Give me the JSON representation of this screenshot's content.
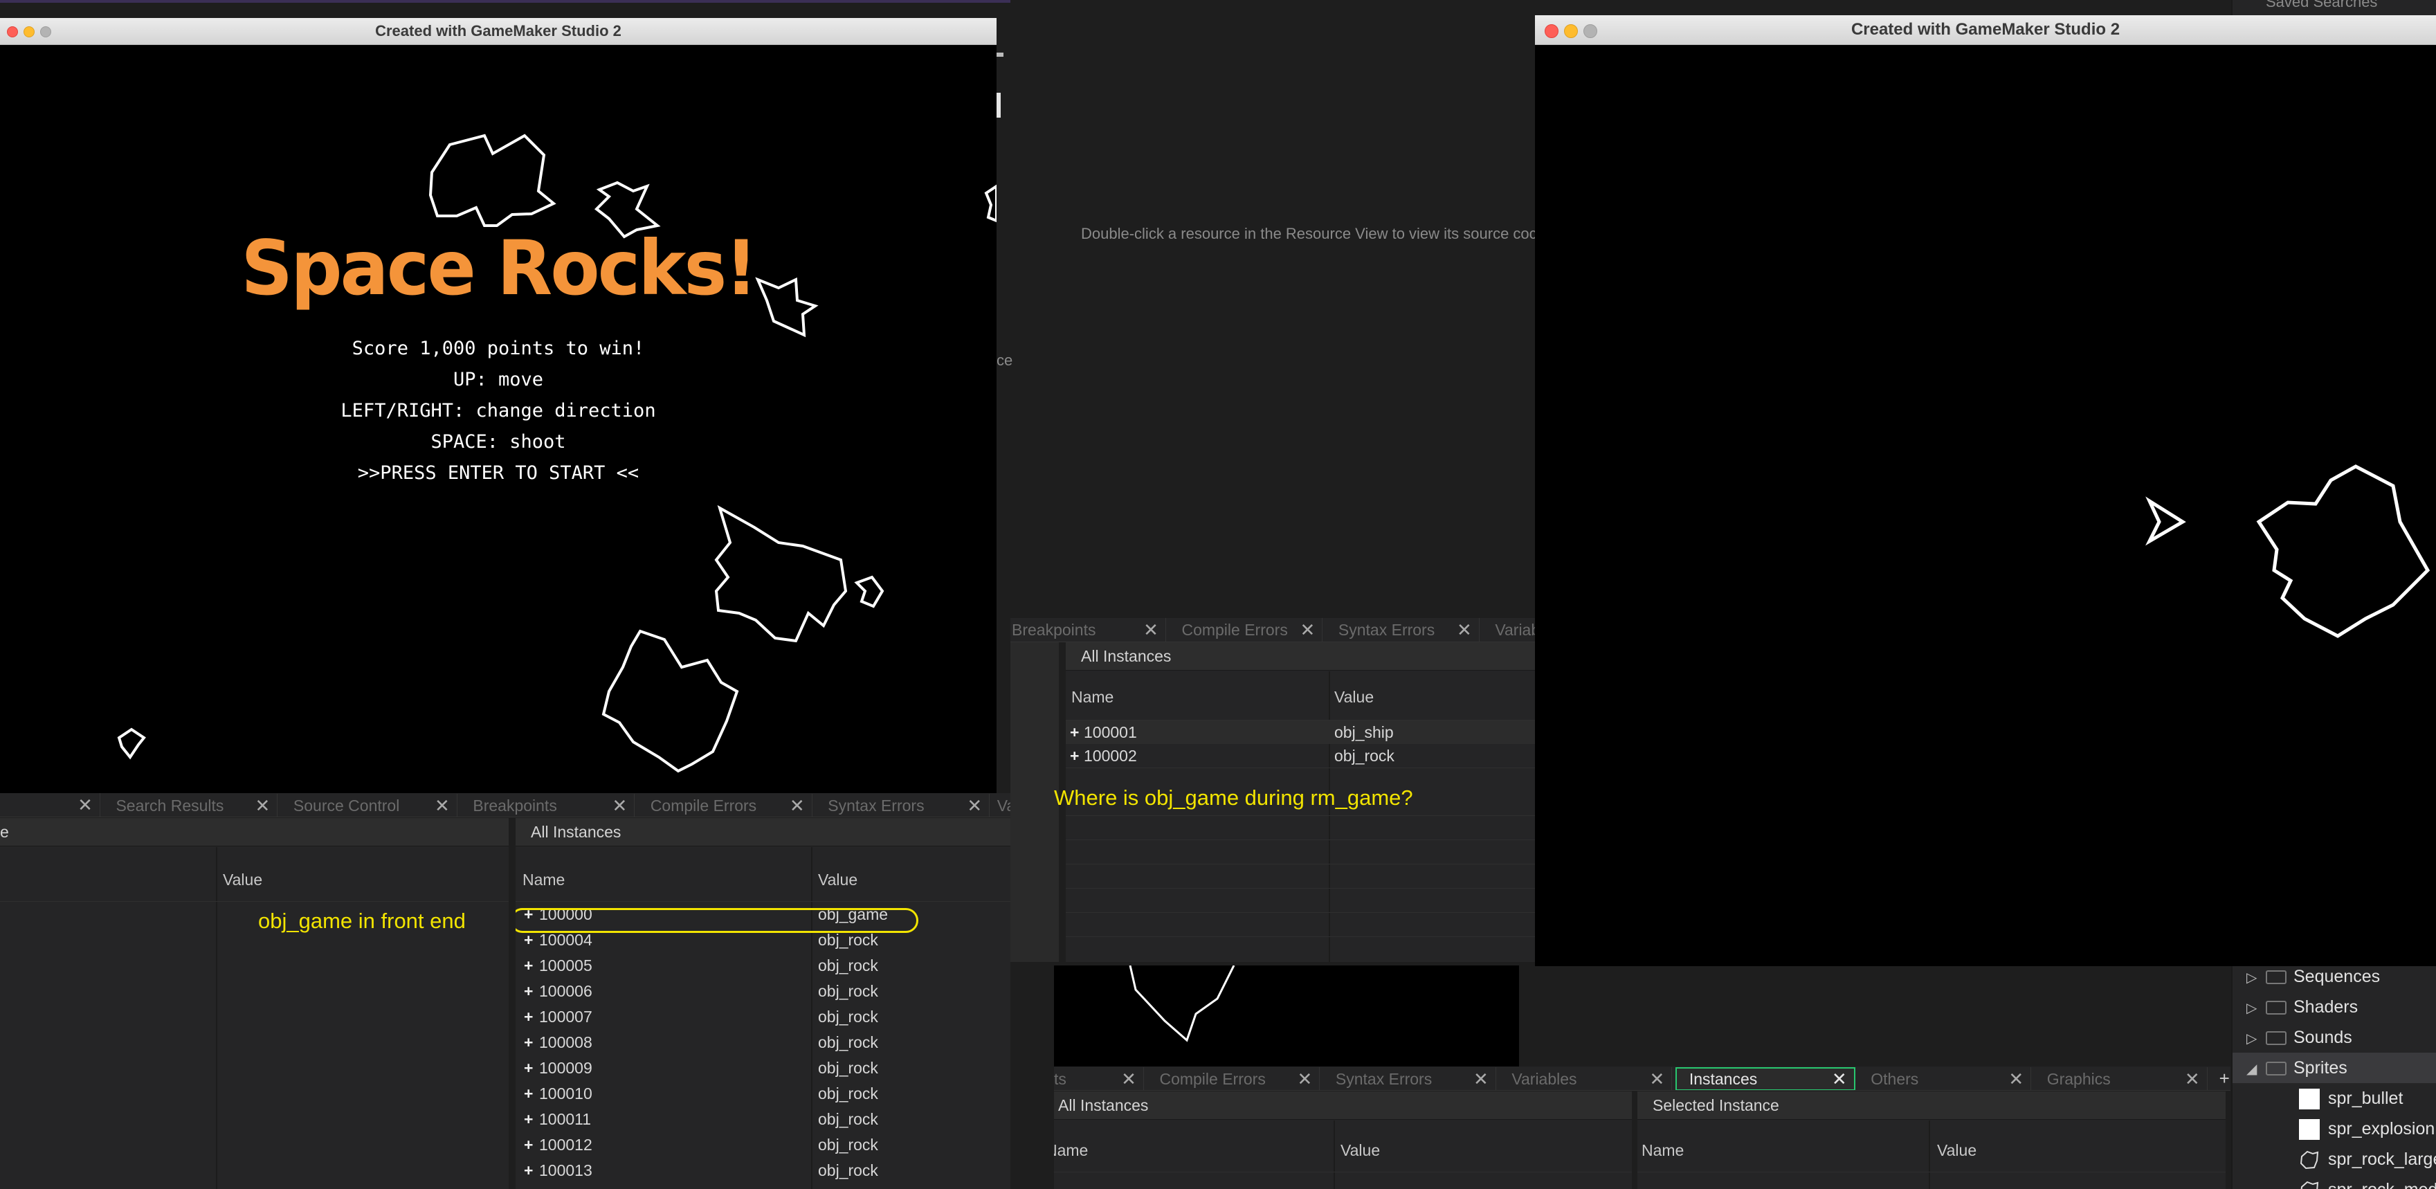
{
  "game_window_left": {
    "title": "Created with GameMaker Studio 2",
    "logo": "Space Rocks!",
    "lines": [
      "Score 1,000 points to win!",
      "UP: move",
      "LEFT/RIGHT: change direction",
      "SPACE: shoot",
      ">>PRESS ENTER TO START <<"
    ]
  },
  "game_window_right": {
    "title": "Created with GameMaker Studio 2"
  },
  "ide_center": {
    "hint": "Double-click a resource in the Resource View to view its source coc",
    "fragment_ce": "ce",
    "top_tabs": [
      "Breakpoints",
      "Compile Errors",
      "Syntax Errors",
      "Variable"
    ],
    "panel_title": "All Instances",
    "col_name": "Name",
    "col_value": "Value",
    "rows": [
      {
        "id": "100001",
        "value": "obj_ship"
      },
      {
        "id": "100002",
        "value": "obj_rock"
      }
    ],
    "annotation": "Where is obj_game during rm_game?"
  },
  "ide_left_bottom": {
    "tabs": [
      "Search Results",
      "Source Control",
      "Breakpoints",
      "Compile Errors",
      "Syntax Errors",
      "Varia"
    ],
    "left_panel_fragment": "e",
    "left_col_value": "Value",
    "annotation": "obj_game in front end",
    "panel_title": "All Instances",
    "col_name": "Name",
    "col_value": "Value",
    "rows": [
      {
        "id": "100000",
        "value": "obj_game"
      },
      {
        "id": "100004",
        "value": "obj_rock"
      },
      {
        "id": "100005",
        "value": "obj_rock"
      },
      {
        "id": "100006",
        "value": "obj_rock"
      },
      {
        "id": "100007",
        "value": "obj_rock"
      },
      {
        "id": "100008",
        "value": "obj_rock"
      },
      {
        "id": "100009",
        "value": "obj_rock"
      },
      {
        "id": "100010",
        "value": "obj_rock"
      },
      {
        "id": "100011",
        "value": "obj_rock"
      },
      {
        "id": "100012",
        "value": "obj_rock"
      },
      {
        "id": "100013",
        "value": "obj_rock"
      }
    ]
  },
  "ide_right_bottom": {
    "tabs": [
      "ts",
      "Compile Errors",
      "Syntax Errors",
      "Variables",
      "Instances",
      "Others",
      "Graphics"
    ],
    "active_tab": "Instances",
    "all_instances": {
      "title": "All Instances",
      "col_name": "Name",
      "col_value": "Value",
      "name_fragment": "Name"
    },
    "selected_instance": {
      "title": "Selected Instance",
      "col_name": "Name",
      "col_value": "Value"
    }
  },
  "resource_tree": {
    "top_fragment": "Saved Searches",
    "items": [
      {
        "label": "Sequences",
        "kind": "folder",
        "expanded": false
      },
      {
        "label": "Shaders",
        "kind": "folder",
        "expanded": false
      },
      {
        "label": "Sounds",
        "kind": "folder",
        "expanded": false
      },
      {
        "label": "Sprites",
        "kind": "folder",
        "expanded": true
      },
      {
        "label": "spr_bullet",
        "kind": "sprite"
      },
      {
        "label": "spr_explosion",
        "kind": "sprite"
      },
      {
        "label": "spr_rock_large",
        "kind": "sprite-rock"
      },
      {
        "label": "spr_rock_medi",
        "kind": "sprite-rock"
      }
    ]
  },
  "colors": {
    "title_orange": "#f4943a",
    "annotation_yellow": "#f2e400",
    "active_tab_border": "#28c76f"
  }
}
